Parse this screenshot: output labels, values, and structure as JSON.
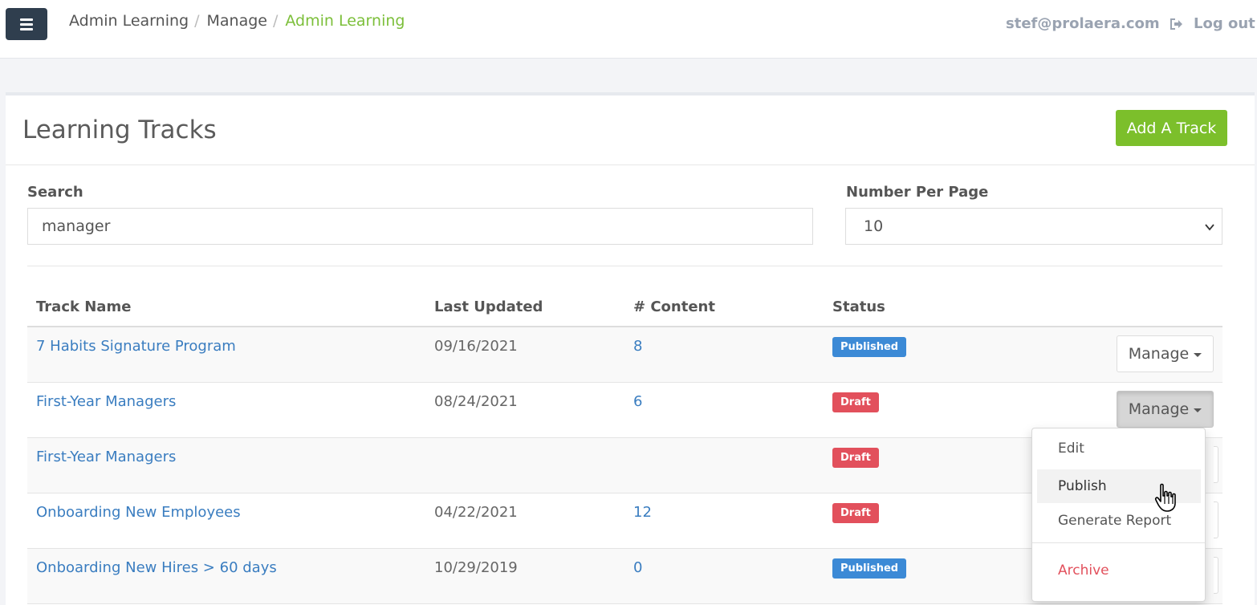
{
  "topbar": {
    "breadcrumb": [
      "Admin Learning",
      "Manage",
      "Admin Learning"
    ],
    "separator": "/",
    "user_email": "stef@prolaera.com",
    "logout_label": "Log out"
  },
  "panel": {
    "title": "Learning Tracks",
    "add_button": "Add A Track"
  },
  "filters": {
    "search_label": "Search",
    "search_value": "manager",
    "per_page_label": "Number Per Page",
    "per_page_value": "10"
  },
  "table": {
    "headers": [
      "Track Name",
      "Last Updated",
      "# Content",
      "Status"
    ],
    "manage_label": "Manage",
    "rows": [
      {
        "name": "7 Habits Signature Program",
        "updated": "09/16/2021",
        "content": "8",
        "status": "Published"
      },
      {
        "name": "First-Year Managers",
        "updated": "08/24/2021",
        "content": "6",
        "status": "Draft"
      },
      {
        "name": "First-Year Managers",
        "updated": "",
        "content": "",
        "status": "Draft"
      },
      {
        "name": "Onboarding New Employees",
        "updated": "04/22/2021",
        "content": "12",
        "status": "Draft"
      },
      {
        "name": "Onboarding New Hires > 60 days",
        "updated": "10/29/2019",
        "content": "0",
        "status": "Published"
      }
    ]
  },
  "dropdown": {
    "items": [
      "Edit",
      "Publish",
      "Generate Report"
    ],
    "danger_item": "Archive"
  },
  "colors": {
    "accent_green": "#7cbf2b",
    "link_blue": "#3a7dc0",
    "published": "#3c8ad6",
    "draft": "#e2505c",
    "topbar_button": "#2f3e4e"
  },
  "icons": [
    "hamburger-icon",
    "logout-icon",
    "chevron-down-icon",
    "caret-down-icon",
    "hand-pointer-icon"
  ]
}
